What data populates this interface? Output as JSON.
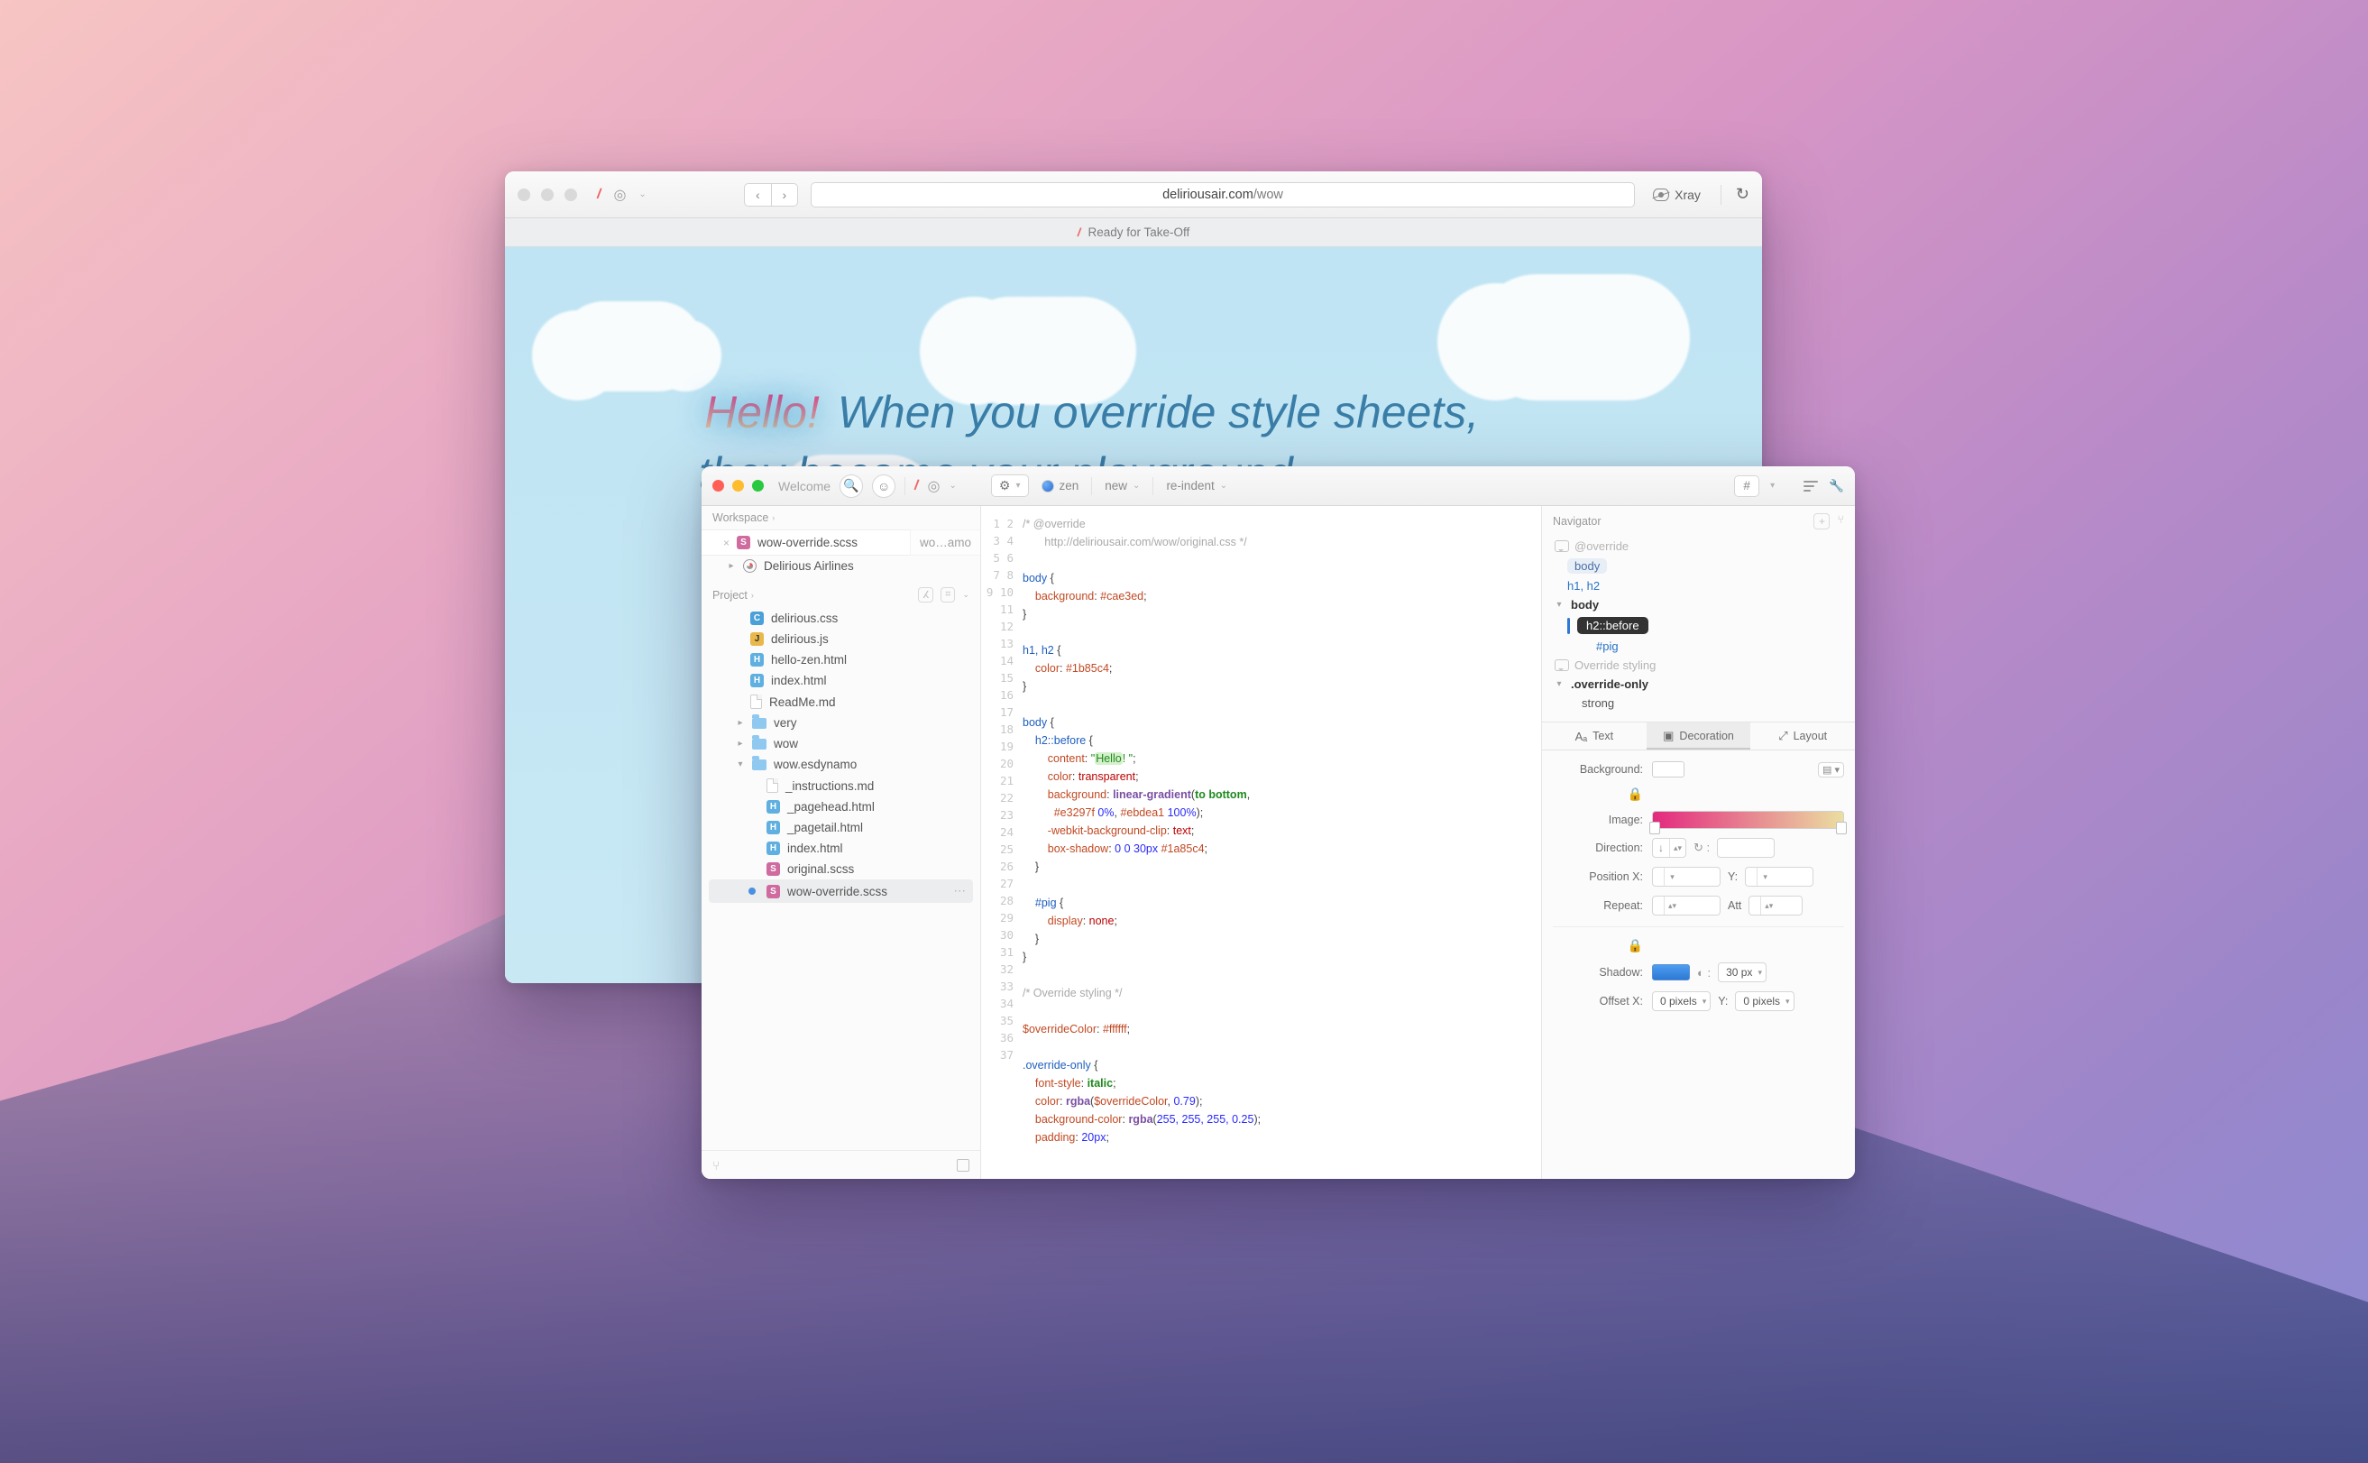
{
  "browser": {
    "url_prefix": "deliriousair.com",
    "url_path": "/wow",
    "xray_label": "Xray",
    "tab_title": "Ready for Take-Off",
    "hero_hello": "Hello!",
    "hero_rest1": " When you override style sheets,",
    "hero_rest2": "they become your playground."
  },
  "editor": {
    "title": "Welcome",
    "workspace_label": "Workspace",
    "project_label": "Project",
    "open_tabs": [
      "wow-override.scss",
      "wo…amo"
    ],
    "workspace_items": [
      "Delirious Airlines"
    ],
    "project_tree": {
      "root_files": [
        "delirious.css",
        "delirious.js",
        "hello-zen.html",
        "index.html",
        "ReadMe.md"
      ],
      "folders": [
        {
          "name": "very",
          "open": false
        },
        {
          "name": "wow",
          "open": false
        },
        {
          "name": "wow.esdynamo",
          "open": true,
          "children": [
            "_instructions.md",
            "_pagehead.html",
            "_pagetail.html",
            "index.html",
            "original.scss",
            "wow-override.scss"
          ]
        }
      ],
      "selected": "wow-override.scss"
    },
    "toolbar": {
      "scheme": "zen",
      "menu_new": "new",
      "menu_reindent": "re-indent"
    },
    "code_start_line": 1,
    "code": [
      {
        "t": "/* @override",
        "cls": "c-cmt"
      },
      {
        "t": "       http://deliriousair.com/wow/original.css */",
        "cls": "c-cmt"
      },
      {
        "t": ""
      },
      {
        "segs": [
          {
            "t": "body ",
            "cls": "c-sel"
          },
          {
            "t": "{",
            "cls": "c-brace"
          }
        ]
      },
      {
        "segs": [
          {
            "t": "    background",
            "cls": "c-prop"
          },
          {
            "t": ": ",
            "cls": ""
          },
          {
            "t": "#cae3ed",
            "cls": "c-hex"
          },
          {
            "t": ";"
          }
        ]
      },
      {
        "t": "}",
        "cls": "c-brace"
      },
      {
        "t": ""
      },
      {
        "segs": [
          {
            "t": "h1, h2 ",
            "cls": "c-sel"
          },
          {
            "t": "{",
            "cls": "c-brace"
          }
        ]
      },
      {
        "segs": [
          {
            "t": "    color",
            "cls": "c-prop"
          },
          {
            "t": ": "
          },
          {
            "t": "#1b85c4",
            "cls": "c-hex"
          },
          {
            "t": ";"
          }
        ]
      },
      {
        "t": "}",
        "cls": "c-brace"
      },
      {
        "t": ""
      },
      {
        "segs": [
          {
            "t": "body ",
            "cls": "c-sel"
          },
          {
            "t": "{",
            "cls": "c-brace"
          }
        ]
      },
      {
        "segs": [
          {
            "t": "    h2::before ",
            "cls": "c-sel"
          },
          {
            "t": "{",
            "cls": "c-brace"
          }
        ]
      },
      {
        "segs": [
          {
            "t": "        content",
            "cls": "c-prop"
          },
          {
            "t": ": "
          },
          {
            "t": "\"",
            "cls": "c-str"
          },
          {
            "t": "Hello",
            "cls": "c-str hlstr"
          },
          {
            "t": "! \"",
            "cls": "c-str"
          },
          {
            "t": ";"
          }
        ]
      },
      {
        "segs": [
          {
            "t": "        color",
            "cls": "c-prop"
          },
          {
            "t": ": "
          },
          {
            "t": "transparent",
            "cls": "c-kwc"
          },
          {
            "t": ";"
          }
        ]
      },
      {
        "segs": [
          {
            "t": "        background",
            "cls": "c-prop"
          },
          {
            "t": ": "
          },
          {
            "t": "linear-gradient",
            "cls": "c-func"
          },
          {
            "t": "("
          },
          {
            "t": "to bottom",
            "cls": "c-kw"
          },
          {
            "t": ","
          }
        ]
      },
      {
        "segs": [
          {
            "t": "          "
          },
          {
            "t": "#e3297f",
            "cls": "c-hex"
          },
          {
            "t": " "
          },
          {
            "t": "0%",
            "cls": "c-num"
          },
          {
            "t": ", "
          },
          {
            "t": "#ebdea1",
            "cls": "c-hex"
          },
          {
            "t": " "
          },
          {
            "t": "100%",
            "cls": "c-num"
          },
          {
            "t": ");"
          }
        ]
      },
      {
        "segs": [
          {
            "t": "        -webkit-background-clip",
            "cls": "c-prop"
          },
          {
            "t": ": "
          },
          {
            "t": "text",
            "cls": "c-kwc"
          },
          {
            "t": ";"
          }
        ]
      },
      {
        "segs": [
          {
            "t": "        box-shadow",
            "cls": "c-prop"
          },
          {
            "t": ": "
          },
          {
            "t": "0 0 30px ",
            "cls": "c-num"
          },
          {
            "t": "#1a85c4",
            "cls": "c-hex"
          },
          {
            "t": ";"
          }
        ]
      },
      {
        "t": "    }",
        "cls": "c-brace"
      },
      {
        "t": ""
      },
      {
        "segs": [
          {
            "t": "    #pig ",
            "cls": "c-sel"
          },
          {
            "t": "{",
            "cls": "c-brace"
          }
        ]
      },
      {
        "segs": [
          {
            "t": "        display",
            "cls": "c-prop"
          },
          {
            "t": ": "
          },
          {
            "t": "none",
            "cls": "c-kwc"
          },
          {
            "t": ";"
          }
        ]
      },
      {
        "t": "    }",
        "cls": "c-brace"
      },
      {
        "t": "}",
        "cls": "c-brace"
      },
      {
        "t": ""
      },
      {
        "t": "/* Override styling */",
        "cls": "c-cmt"
      },
      {
        "t": ""
      },
      {
        "segs": [
          {
            "t": "$overrideColor",
            "cls": "c-var"
          },
          {
            "t": ": "
          },
          {
            "t": "#ffffff",
            "cls": "c-hex"
          },
          {
            "t": ";"
          }
        ]
      },
      {
        "t": ""
      },
      {
        "segs": [
          {
            "t": ".override-only ",
            "cls": "c-sel"
          },
          {
            "t": "{",
            "cls": "c-brace"
          }
        ]
      },
      {
        "segs": [
          {
            "t": "    font-style",
            "cls": "c-prop"
          },
          {
            "t": ": "
          },
          {
            "t": "italic",
            "cls": "c-kw"
          },
          {
            "t": ";"
          }
        ]
      },
      {
        "segs": [
          {
            "t": "    color",
            "cls": "c-prop"
          },
          {
            "t": ": "
          },
          {
            "t": "rgba",
            "cls": "c-func"
          },
          {
            "t": "("
          },
          {
            "t": "$overrideColor",
            "cls": "c-var"
          },
          {
            "t": ", "
          },
          {
            "t": "0.79",
            "cls": "c-num"
          },
          {
            "t": ");"
          }
        ]
      },
      {
        "segs": [
          {
            "t": "    background-color",
            "cls": "c-prop"
          },
          {
            "t": ": "
          },
          {
            "t": "rgba",
            "cls": "c-func"
          },
          {
            "t": "("
          },
          {
            "t": "255, 255, 255, 0.25",
            "cls": "c-num"
          },
          {
            "t": ");"
          }
        ]
      },
      {
        "segs": [
          {
            "t": "    padding",
            "cls": "c-prop"
          },
          {
            "t": ": "
          },
          {
            "t": "20px",
            "cls": "c-num"
          },
          {
            "t": ";"
          }
        ]
      },
      {
        "t": ""
      },
      {
        "t": ""
      }
    ],
    "navigator": {
      "title": "Navigator",
      "items": [
        {
          "kind": "comment",
          "label": "@override"
        },
        {
          "kind": "chip",
          "label": "body"
        },
        {
          "kind": "link",
          "label": "h1, h2"
        },
        {
          "kind": "bold",
          "label": "body",
          "expanded": true
        },
        {
          "kind": "selected",
          "label": "h2::before"
        },
        {
          "kind": "link",
          "label": "#pig",
          "indent": 3
        },
        {
          "kind": "comment",
          "label": "Override styling"
        },
        {
          "kind": "bold",
          "label": ".override-only",
          "expanded": true
        },
        {
          "kind": "plain",
          "label": "strong",
          "indent": 2
        }
      ]
    },
    "inspector": {
      "tabs": [
        "Text",
        "Decoration",
        "Layout"
      ],
      "active_tab": 1,
      "labels": {
        "background": "Background:",
        "image": "Image:",
        "direction": "Direction:",
        "posx": "Position X:",
        "posy_short": "Y:",
        "repeat": "Repeat:",
        "att": "Att",
        "shadow": "Shadow:",
        "offx": "Offset X:",
        "offy_short": "Y:",
        "rotate_sym": "↻ :"
      },
      "values": {
        "direction_arrow": "↓",
        "shadow_size": "30 px",
        "offset_x": "0 pixels",
        "offset_y": "0 pixels"
      }
    }
  }
}
